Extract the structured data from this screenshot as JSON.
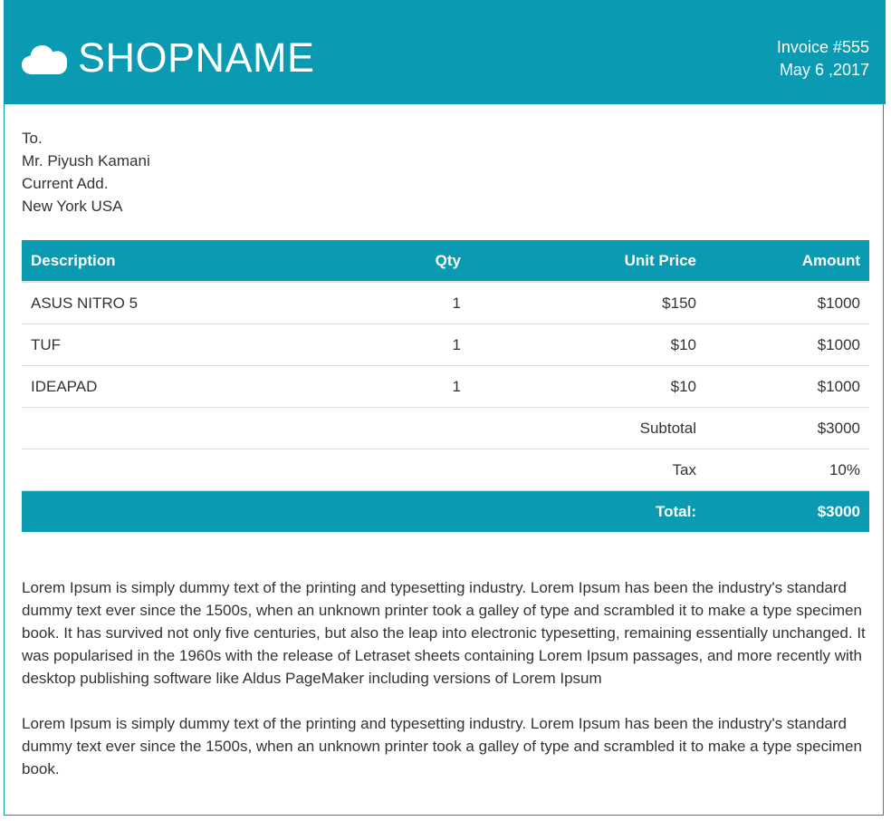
{
  "header": {
    "shop_name": "SHOPNAME",
    "icon": "cloud-icon",
    "invoice_number": "Invoice #555",
    "invoice_date": "May 6 ,2017"
  },
  "recipient": {
    "line1": "To.",
    "line2": "Mr. Piyush Kamani",
    "line3": "Current Add.",
    "line4": "New York USA"
  },
  "table": {
    "headers": {
      "description": "Description",
      "qty": "Qty",
      "unit_price": "Unit Price",
      "amount": "Amount"
    },
    "rows": [
      {
        "description": "ASUS NITRO 5",
        "qty": "1",
        "unit_price": "$150",
        "amount": "$1000"
      },
      {
        "description": "TUF",
        "qty": "1",
        "unit_price": "$10",
        "amount": "$1000"
      },
      {
        "description": "IDEAPAD",
        "qty": "1",
        "unit_price": "$10",
        "amount": "$1000"
      }
    ],
    "subtotal_label": "Subtotal",
    "subtotal_value": "$3000",
    "tax_label": "Tax",
    "tax_value": "10%",
    "total_label": "Total:",
    "total_value": "$3000"
  },
  "notes": {
    "paragraph1": "Lorem Ipsum is simply dummy text of the printing and typesetting industry. Lorem Ipsum has been the industry's standard dummy text ever since the 1500s, when an unknown printer took a galley of type and scrambled it to make a type specimen book. It has survived not only five centuries, but also the leap into electronic typesetting, remaining essentially unchanged. It was popularised in the 1960s with the release of Letraset sheets containing Lorem Ipsum passages, and more recently with desktop publishing software like Aldus PageMaker including versions of Lorem Ipsum",
    "paragraph2": "Lorem Ipsum is simply dummy text of the printing and typesetting industry. Lorem Ipsum has been the industry's standard dummy text ever since the 1500s, when an unknown printer took a galley of type and scrambled it to make a type specimen book."
  },
  "colors": {
    "accent": "#0a9ab2",
    "text": "#333333",
    "row_border": "#dddddd"
  }
}
